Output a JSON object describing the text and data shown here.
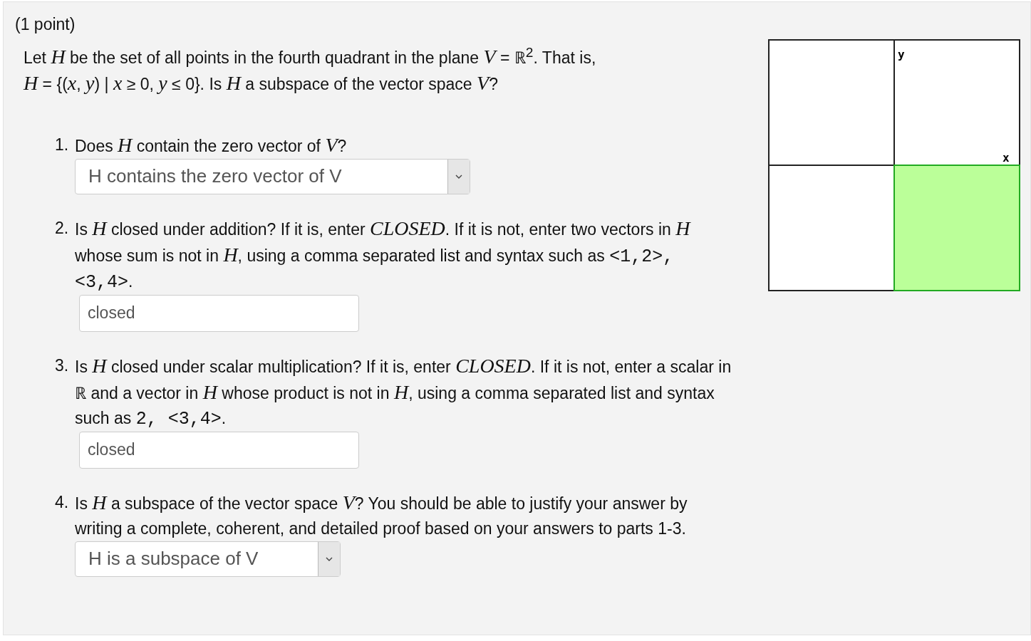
{
  "points": "(1 point)",
  "intro": [
    "Let *H* be the set of all points in the fourth quadrant in the plane *V* = ℝ$^{2}$. That is,",
    "*H* = {(*x*, *y*) | *x* ≥ 0, *y* ≤ 0}. Is *H* a subspace of the vector space *V*?"
  ],
  "questions": [
    {
      "number": "1.",
      "kind": "select",
      "prompt": [
        {
          "kind": "text",
          "text": "Does *H* contain the zero vector of *V*?"
        }
      ],
      "value": "H contains the zero vector of V"
    },
    {
      "number": "2.",
      "kind": "text",
      "prompt": [
        {
          "kind": "text",
          "text": "Is *H* closed under addition? If it is, enter *CLOSED*. If it is not, enter two vectors in *H* whose sum is not in *H*, using a comma separated list and syntax such as "
        },
        {
          "kind": "code",
          "text": "<1,2>, <3,4>"
        },
        {
          "kind": "text",
          "text": "."
        }
      ],
      "value": "closed"
    },
    {
      "number": "3.",
      "kind": "text",
      "prompt": [
        {
          "kind": "text",
          "text": "Is *H* closed under scalar multiplication? If it is, enter *CLOSED*. If it is not, enter a scalar in ℝ and a vector in *H* whose product is not in *H*, using a comma separated list and syntax such as "
        },
        {
          "kind": "code",
          "text": "2, <3,4>"
        },
        {
          "kind": "text",
          "text": "."
        }
      ],
      "value": "closed"
    },
    {
      "number": "4.",
      "kind": "select",
      "prompt": [
        {
          "kind": "text",
          "text": "Is *H* a subspace of the vector space *V*? You should be able to justify your answer by writing a complete, coherent, and detailed proof based on your answers to parts 1-3."
        }
      ],
      "value": "H is a subspace of V"
    }
  ],
  "graph": {
    "x_label": "x",
    "y_label": "y",
    "quadrants": [
      {
        "shaded": false
      },
      {
        "shaded": false
      },
      {
        "shaded": false
      },
      {
        "shaded": true
      }
    ]
  }
}
